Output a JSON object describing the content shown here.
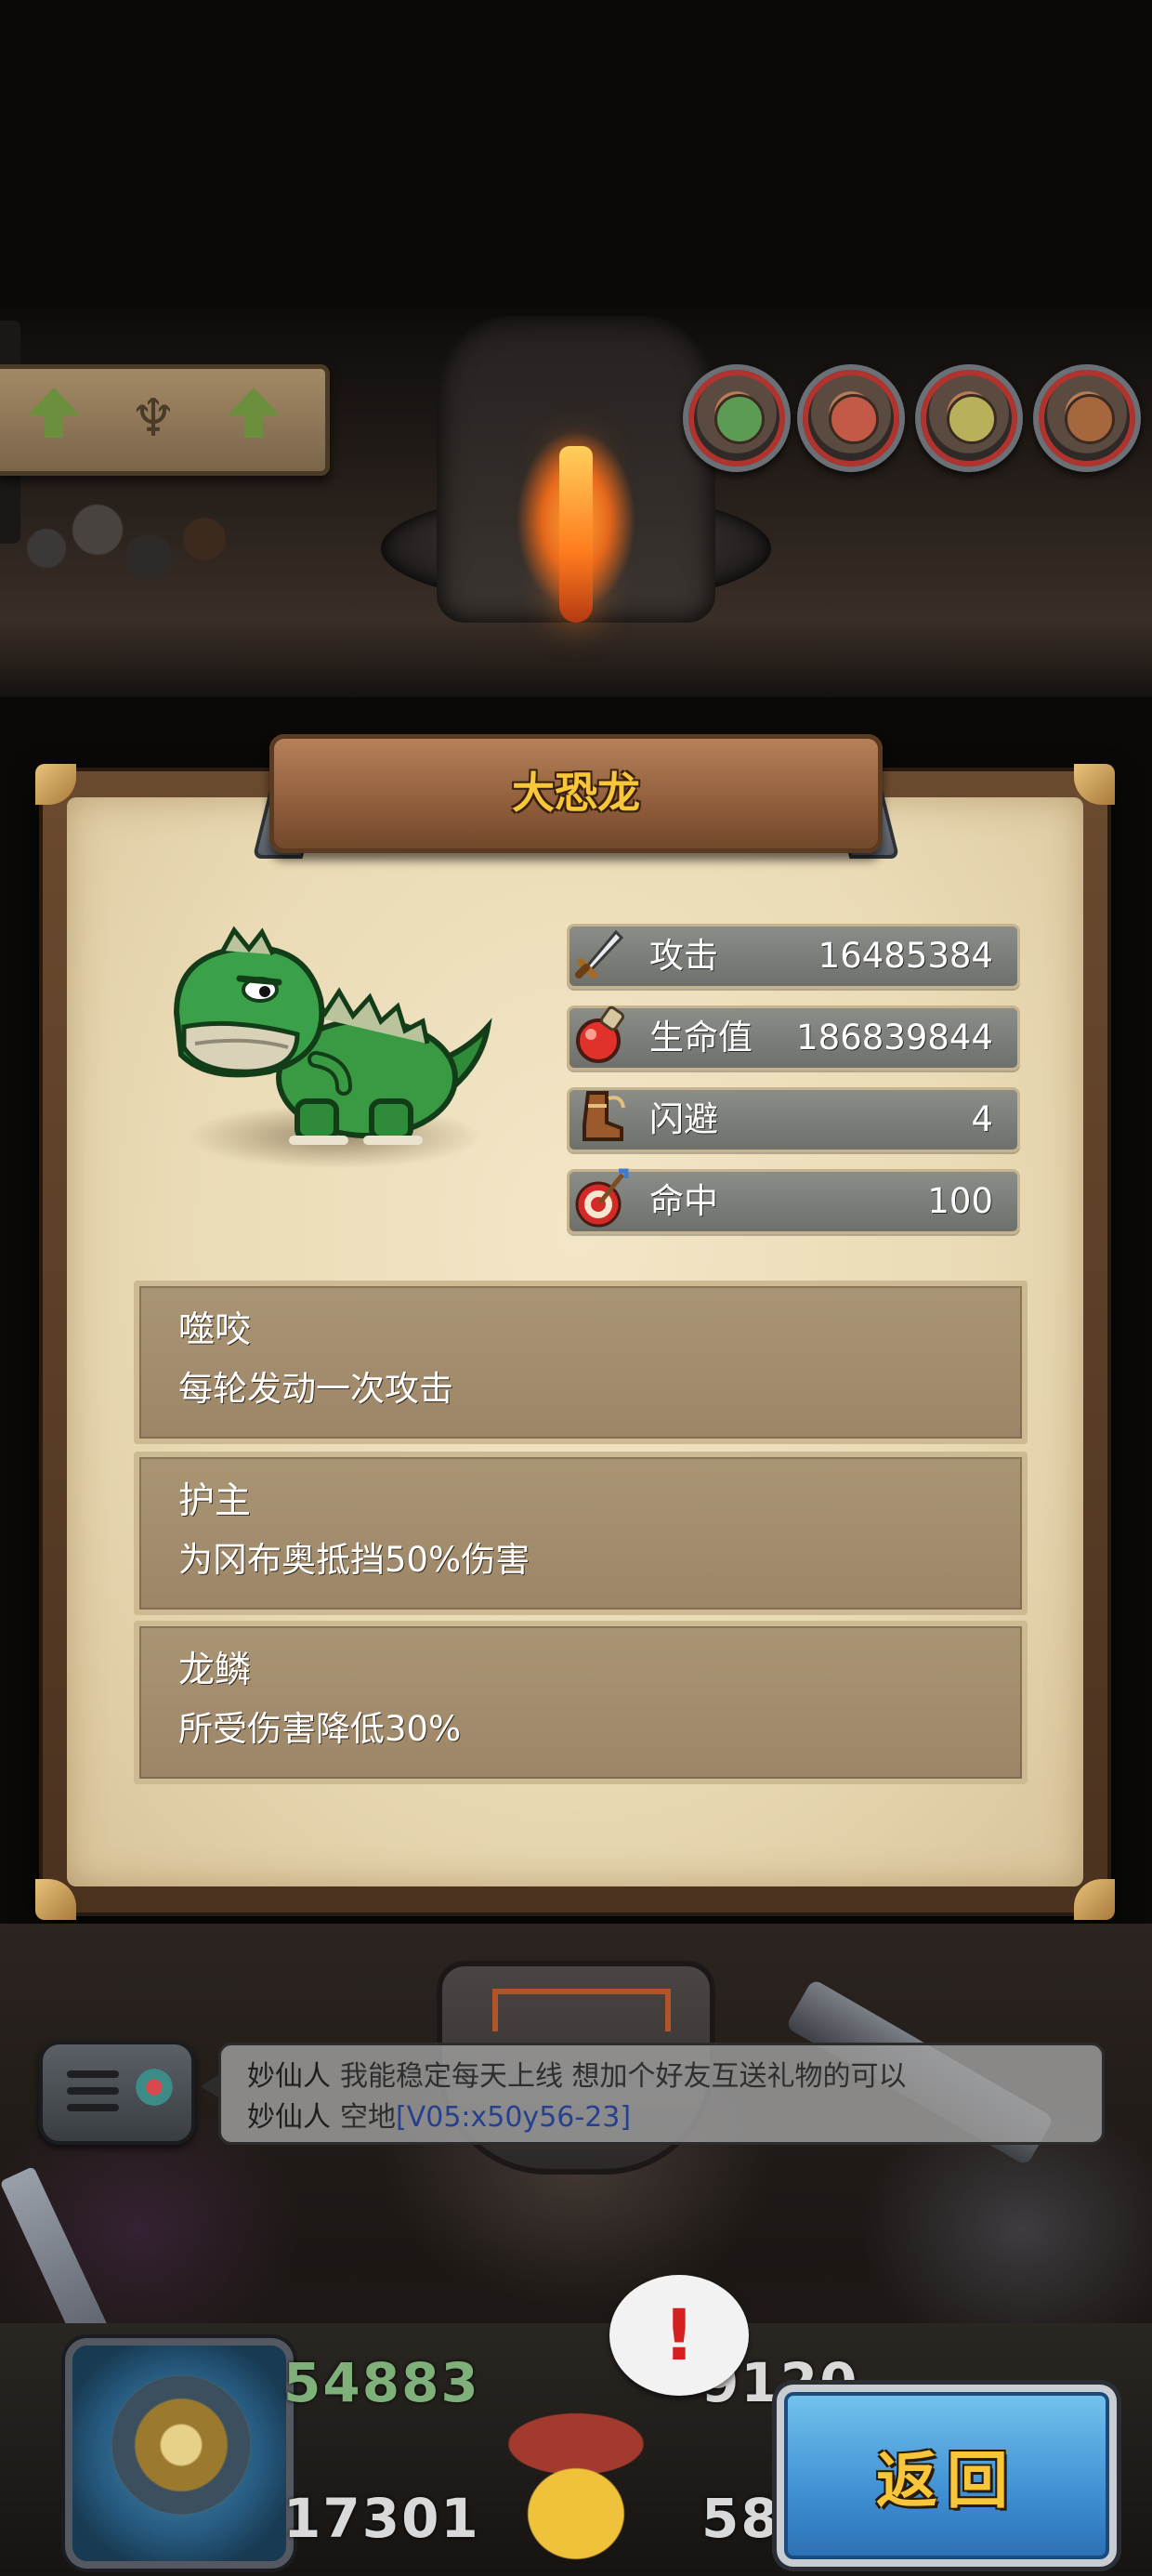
{
  "creature": {
    "name": "大恐龙",
    "image_icon": "green-dinosaur-icon"
  },
  "stats": [
    {
      "label": "攻击",
      "value": "16485384",
      "icon": "sword-icon"
    },
    {
      "label": "生命值",
      "value": "186839844",
      "icon": "potion-icon"
    },
    {
      "label": "闪避",
      "value": "4",
      "icon": "boot-icon"
    },
    {
      "label": "命中",
      "value": "100",
      "icon": "target-icon"
    }
  ],
  "skills": [
    {
      "name": "噬咬",
      "description": "每轮发动一次攻击"
    },
    {
      "name": "护主",
      "description": "为冈布奥抵挡50%伤害"
    },
    {
      "name": "龙鳞",
      "description": "所受伤害降低30%"
    }
  ],
  "chat": {
    "messages": [
      {
        "sender": "妙仙人",
        "text": "我能稳定每天上线 想加个好友互送礼物的可以",
        "link": ""
      },
      {
        "sender": "妙仙人",
        "text": "空地",
        "link": "[V05:x50y56-23]"
      }
    ]
  },
  "bottom_bar": {
    "counters": {
      "top_left": "54883",
      "bottom_left": "17301",
      "top_right": "9120",
      "bottom_right": "58"
    },
    "alert": "!",
    "return_label": "返回"
  },
  "colors": {
    "title_gold": "#f7c739",
    "parchment": "#eadbb6",
    "stat_bar": "#7d7f7a",
    "skill_box": "#a38e6e",
    "return_button": "#3f90d3"
  }
}
